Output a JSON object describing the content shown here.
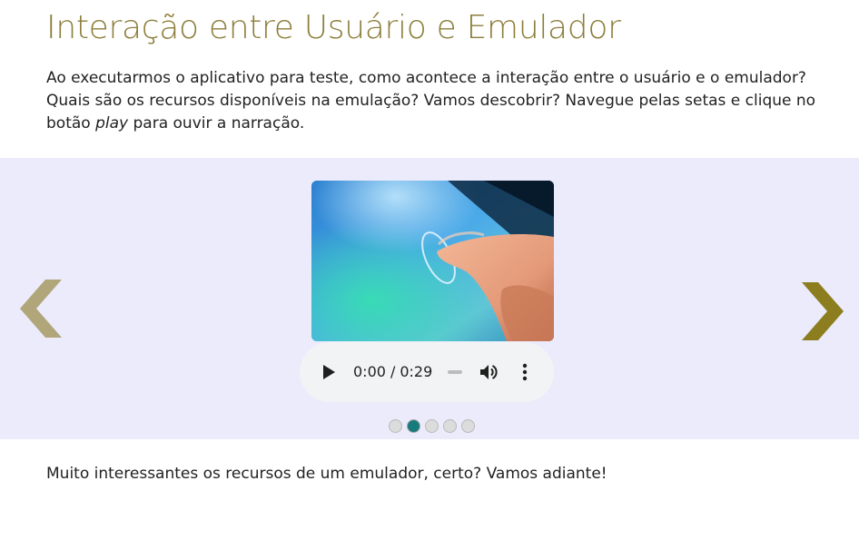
{
  "page": {
    "title": "Interação entre Usuário e Emulador",
    "intro": {
      "before_italic": "Ao executarmos o aplicativo para teste, como acontece a interação entre o usuário e o emulador? Quais são os recursos disponíveis na emulação? Vamos descobrir? Navegue pelas setas e clique no botão ",
      "italic": "play",
      "after_italic": " para ouvir a narração."
    },
    "outro": "Muito interessantes os recursos de um emulador, certo? Vamos adiante!"
  },
  "carousel": {
    "background": "#ebebfc",
    "arrow_prev_color": "#b0a67a",
    "arrow_next_color": "#8c7e1f",
    "active_slide": 2,
    "slide_count": 5,
    "dot_active_color": "#177b7b",
    "slide": {
      "image_icon": "finger-touching-tablet-image"
    }
  },
  "audio": {
    "current_time": "0:00",
    "separator": "/",
    "duration": "0:29",
    "progress": 0,
    "play_icon": "play-icon",
    "volume_icon": "volume-icon",
    "more_icon": "more-vertical-icon"
  }
}
